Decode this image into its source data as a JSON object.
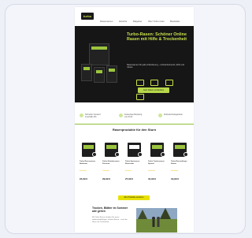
{
  "header": {
    "logo": "turbo",
    "nav": [
      "Rasensamen",
      "Zubehör",
      "Ratgeber",
      "Über Turbo Gras",
      "Bestseller",
      "Gewerblicher Bedarf"
    ]
  },
  "hero": {
    "title": "Turbo-Rasen: Schöner Online Rasen mit Hilfe & Trockenheit",
    "subtitle": "Rasensamen für jede Anforderung – schnell keimend, dicht und robust.",
    "badges": [
      "badge-1",
      "badge-2",
      "badge-3",
      "badge-4"
    ],
    "button": "Jetzt Rasen entdecken"
  },
  "usps": [
    "Schneller Versand innerhalb 24h",
    "Kostenlose Beratung vom Profi",
    "Zufriedenheitsgarantie"
  ],
  "products": {
    "title": "Rasenprodukte für den Sturn",
    "items": [
      {
        "name": "Turbo Rasensamen Nachsaat",
        "rating": "★★★★★",
        "price": "24,99 €"
      },
      {
        "name": "Turbo Schattenrasen Premium",
        "rating": "★★★★★",
        "price": "29,99 €"
      },
      {
        "name": "Turbo Sportrasen Rasensaat",
        "rating": "★★★★☆",
        "price": "27,99 €"
      },
      {
        "name": "Turbo Trockenrasen Spezial",
        "rating": "★★★★★",
        "price": "31,99 €"
      },
      {
        "name": "Turbo Rasendünger Starter",
        "rating": "★★★★★",
        "price": "19,99 €"
      }
    ],
    "cta": "Alle Produkte ansehen"
  },
  "lawn": {
    "title": "Trocken, Blätter im Sommer ade gehen",
    "text": "Mit Turbo Rasen erhalten Sie einen widerstandsfähigen, dichten Rasen – auch bei Hitze und Trockenheit."
  },
  "colors": {
    "accent": "#c7e04a",
    "hero_bg": "#161616",
    "cta": "#e8e000"
  }
}
